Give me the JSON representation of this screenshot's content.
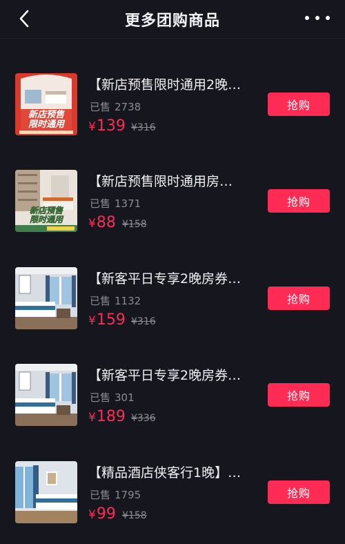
{
  "header": {
    "title": "更多团购商品"
  },
  "colors": {
    "background": "#16161f",
    "accent": "#fe2c55",
    "muted": "#8b8b95"
  },
  "items": [
    {
      "name": "【新店预售限时通用2晚…",
      "sold_label": "已售",
      "sold_count": "2738",
      "currency": "¥",
      "price": "139",
      "original_price": "¥316",
      "buy_label": "抢购",
      "thumb_text_1": "新店预售",
      "thumb_text_2": "限时通用"
    },
    {
      "name": "【新店预售限时通用房…",
      "sold_label": "已售",
      "sold_count": "1371",
      "currency": "¥",
      "price": "88",
      "original_price": "¥158",
      "buy_label": "抢购",
      "thumb_text_1": "新店预售",
      "thumb_text_2": "限时通用"
    },
    {
      "name": "【新客平日专享2晚房券…",
      "sold_label": "已售",
      "sold_count": "1132",
      "currency": "¥",
      "price": "159",
      "original_price": "¥316",
      "buy_label": "抢购"
    },
    {
      "name": "【新客平日专享2晚房券…",
      "sold_label": "已售",
      "sold_count": "301",
      "currency": "¥",
      "price": "189",
      "original_price": "¥336",
      "buy_label": "抢购"
    },
    {
      "name": "【精品酒店侠客行1晚】…",
      "sold_label": "已售",
      "sold_count": "1795",
      "currency": "¥",
      "price": "99",
      "original_price": "¥158",
      "buy_label": "抢购"
    }
  ]
}
